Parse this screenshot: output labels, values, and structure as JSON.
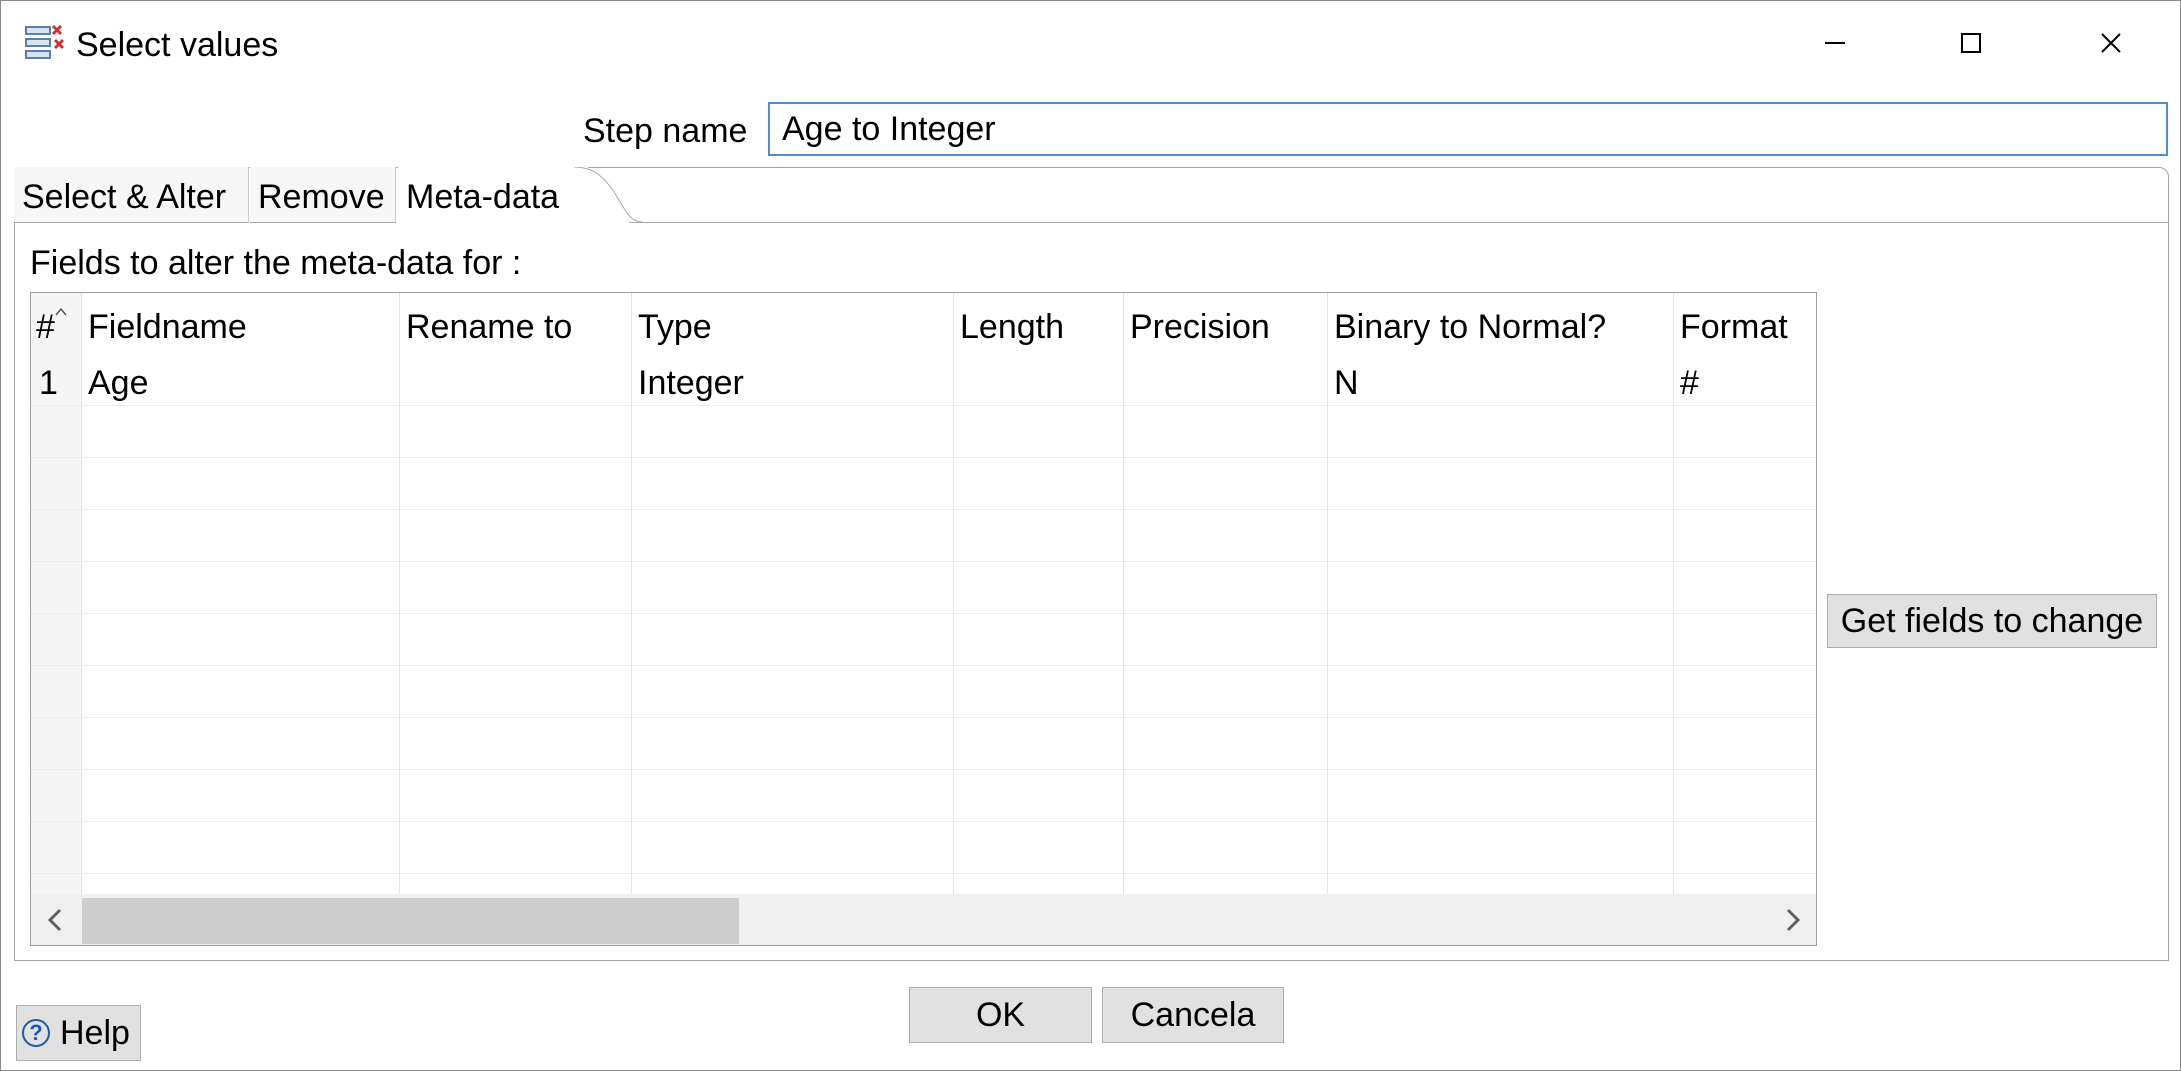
{
  "window": {
    "title": "Select values",
    "icon": "select-values-icon",
    "controls": [
      "minimize-icon",
      "maximize-icon",
      "close-icon"
    ]
  },
  "step_name": {
    "label": "Step name",
    "value": "Age to Integer"
  },
  "tabs": [
    {
      "label": "Select & Alter",
      "active": false
    },
    {
      "label": "Remove",
      "active": false
    },
    {
      "label": "Meta-data",
      "active": true
    }
  ],
  "metadata": {
    "section_label": "Fields to alter the meta-data for :",
    "columns": [
      "#",
      "Fieldname",
      "Rename to",
      "Type",
      "Length",
      "Precision",
      "Binary to Normal?",
      "Format"
    ],
    "rows": [
      {
        "num": "1",
        "fieldname": "Age",
        "rename_to": "",
        "type": "Integer",
        "length": "",
        "precision": "",
        "binary_to_normal": "N",
        "format": "#"
      }
    ],
    "get_fields_label": "Get fields to change"
  },
  "buttons": {
    "ok": "OK",
    "cancel": "Cancela",
    "help": "Help"
  },
  "colors": {
    "input_border": "#4f8fd0",
    "button_bg": "#e1e1e1",
    "help_icon": "#1e5aa8"
  }
}
